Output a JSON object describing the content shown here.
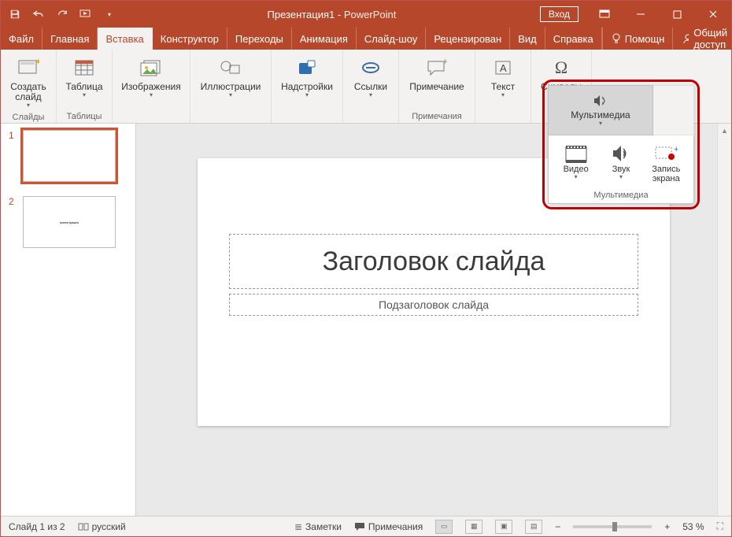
{
  "titlebar": {
    "doc": "Презентация1",
    "app": "PowerPoint",
    "signin": "Вход"
  },
  "tabs": {
    "file": "Файл",
    "home": "Главная",
    "insert": "Вставка",
    "design": "Конструктор",
    "transitions": "Переходы",
    "animations": "Анимация",
    "slideshow": "Слайд-шоу",
    "review": "Рецензирован",
    "view": "Вид",
    "help": "Справка",
    "tellme": "Помощн",
    "share": "Общий доступ"
  },
  "ribbon": {
    "new_slide": "Создать\nслайд",
    "slides_group": "Слайды",
    "table": "Таблица",
    "tables_group": "Таблицы",
    "images": "Изображения",
    "illustrations": "Иллюстрации",
    "addins": "Надстройки",
    "links": "Ссылки",
    "comment": "Примечание",
    "comments_group": "Примечания",
    "text": "Текст",
    "symbols": "Символы",
    "multimedia": "Мультимедиа"
  },
  "mm": {
    "main": "Мультимедиа",
    "video": "Видео",
    "audio": "Звук",
    "screenrec": "Запись\nэкрана",
    "group": "Мультимедиа"
  },
  "slide": {
    "title": "Заголовок слайда",
    "subtitle": "Подзаголовок слайда"
  },
  "thumbs": {
    "n1": "1",
    "n2": "2",
    "lorem": "lorem ipsum"
  },
  "status": {
    "slide_of": "Слайд 1 из 2",
    "lang": "русский",
    "notes": "Заметки",
    "comments": "Примечания",
    "zoom": "53 %"
  }
}
